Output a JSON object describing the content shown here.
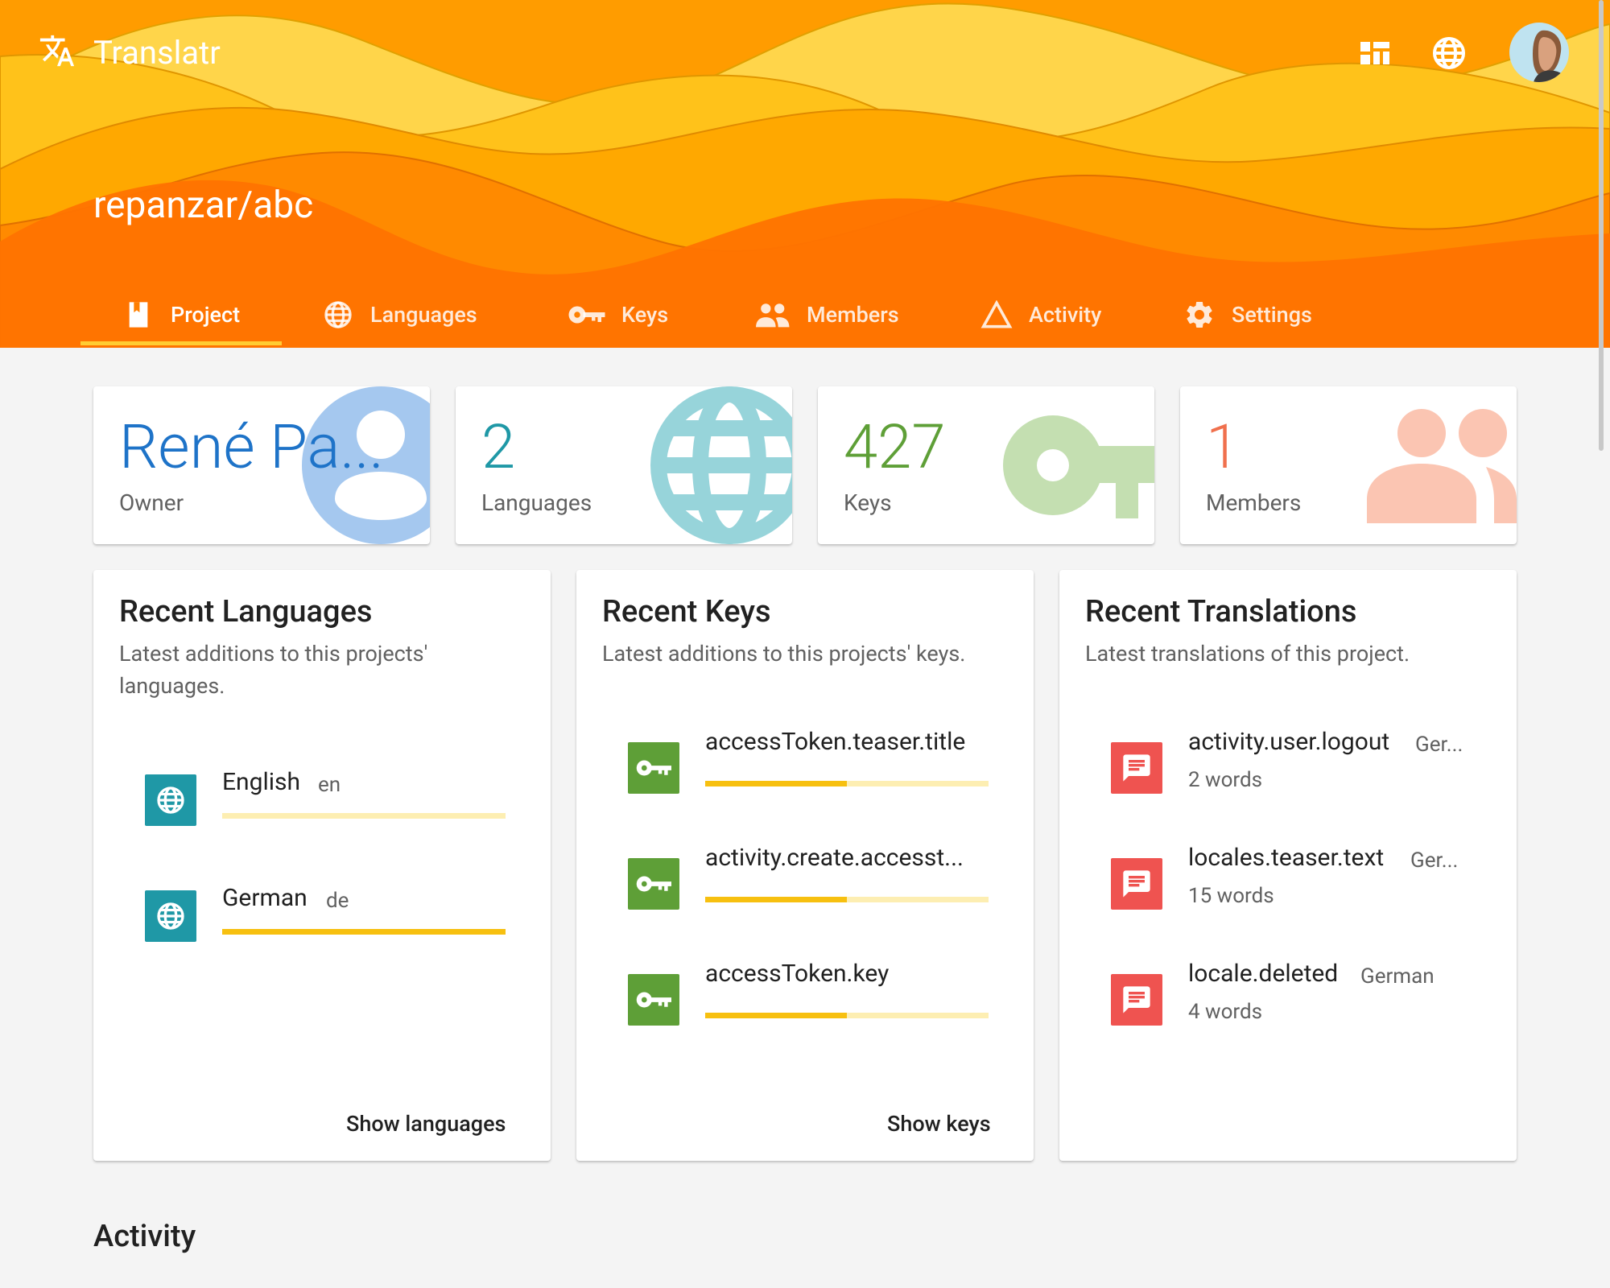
{
  "app": {
    "title": "Translatr"
  },
  "header": {
    "project_name": "repanzar/abc"
  },
  "tabs": [
    {
      "label": "Project",
      "icon": "book-icon",
      "active": true
    },
    {
      "label": "Languages",
      "icon": "globe-icon"
    },
    {
      "label": "Keys",
      "icon": "key-icon"
    },
    {
      "label": "Members",
      "icon": "people-icon"
    },
    {
      "label": "Activity",
      "icon": "triangle-icon"
    },
    {
      "label": "Settings",
      "icon": "gear-icon"
    }
  ],
  "stats": [
    {
      "value": "René Pa...",
      "label": "Owner",
      "color": "#1e73c8",
      "icon": "person-icon"
    },
    {
      "value": "2",
      "label": "Languages",
      "color": "#1f98a6",
      "icon": "globe-icon"
    },
    {
      "value": "427",
      "label": "Keys",
      "color": "#5e9f37",
      "icon": "key-icon"
    },
    {
      "value": "1",
      "label": "Members",
      "color": "#f0704d",
      "icon": "people-icon"
    }
  ],
  "recent_languages": {
    "title": "Recent Languages",
    "subtitle": "Latest additions to this projects' languages.",
    "items": [
      {
        "name": "English",
        "code": "en",
        "progress": 0
      },
      {
        "name": "German",
        "code": "de",
        "progress": 1.0
      }
    ],
    "action": "Show languages"
  },
  "recent_keys": {
    "title": "Recent Keys",
    "subtitle": "Latest additions to this projects' keys.",
    "items": [
      {
        "name": "accessToken.teaser.title",
        "progress": 0.5
      },
      {
        "name": "activity.create.accesst...",
        "progress": 0.5
      },
      {
        "name": "accessToken.key",
        "progress": 0.5
      }
    ],
    "action": "Show keys"
  },
  "recent_translations": {
    "title": "Recent Translations",
    "subtitle": "Latest translations of this project.",
    "items": [
      {
        "name": "activity.user.logout",
        "locale": "Ger...",
        "words": "2 words"
      },
      {
        "name": "locales.teaser.text",
        "locale": "Ger...",
        "words": "15 words"
      },
      {
        "name": "locale.deleted",
        "locale": "German",
        "words": "4 words"
      }
    ]
  },
  "activity": {
    "title": "Activity"
  },
  "colors": {
    "language_badge": "#1f98a6",
    "key_badge": "#5e9f37",
    "translation_badge": "#ef5350",
    "progress_fill": "#f7c010",
    "progress_track": "#fdeeb2"
  }
}
